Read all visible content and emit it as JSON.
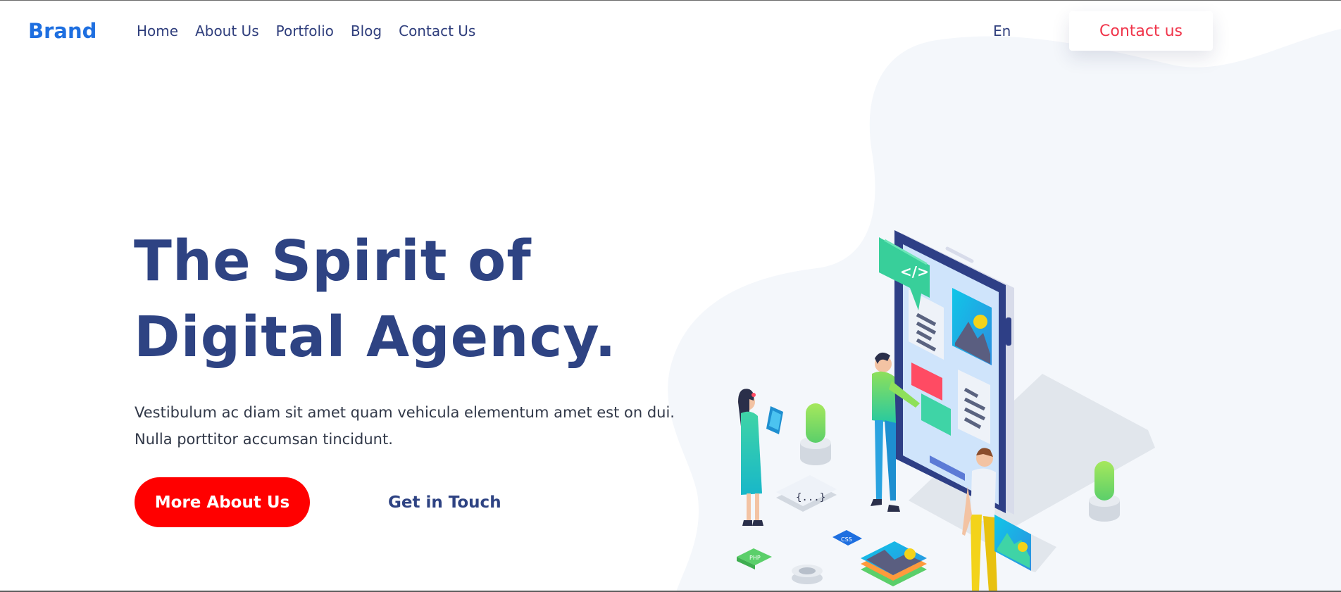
{
  "header": {
    "brand": "Brand",
    "nav": [
      {
        "label": "Home"
      },
      {
        "label": "About Us"
      },
      {
        "label": "Portfolio"
      },
      {
        "label": "Blog"
      },
      {
        "label": "Contact Us"
      }
    ],
    "language": "En",
    "contact_button": "Contact us"
  },
  "hero": {
    "title_line1": "The Spirit of",
    "title_line2": "Digital Agency.",
    "description": "Vestibulum ac diam sit amet quam vehicula elementum amet est on dui. Nulla porttitor accumsan tincidunt.",
    "primary_button": "More About Us",
    "secondary_link": "Get in Touch"
  },
  "illustration": {
    "code_bubble": "</>",
    "braces_tile": "{...}",
    "css_tile": "CSS",
    "php_tile": "PHP"
  },
  "colors": {
    "brand": "#1e6fe0",
    "navy": "#2e4383",
    "accent_red": "#ff0000",
    "contact_red": "#f0344a",
    "blob": "#f4f7fb"
  }
}
